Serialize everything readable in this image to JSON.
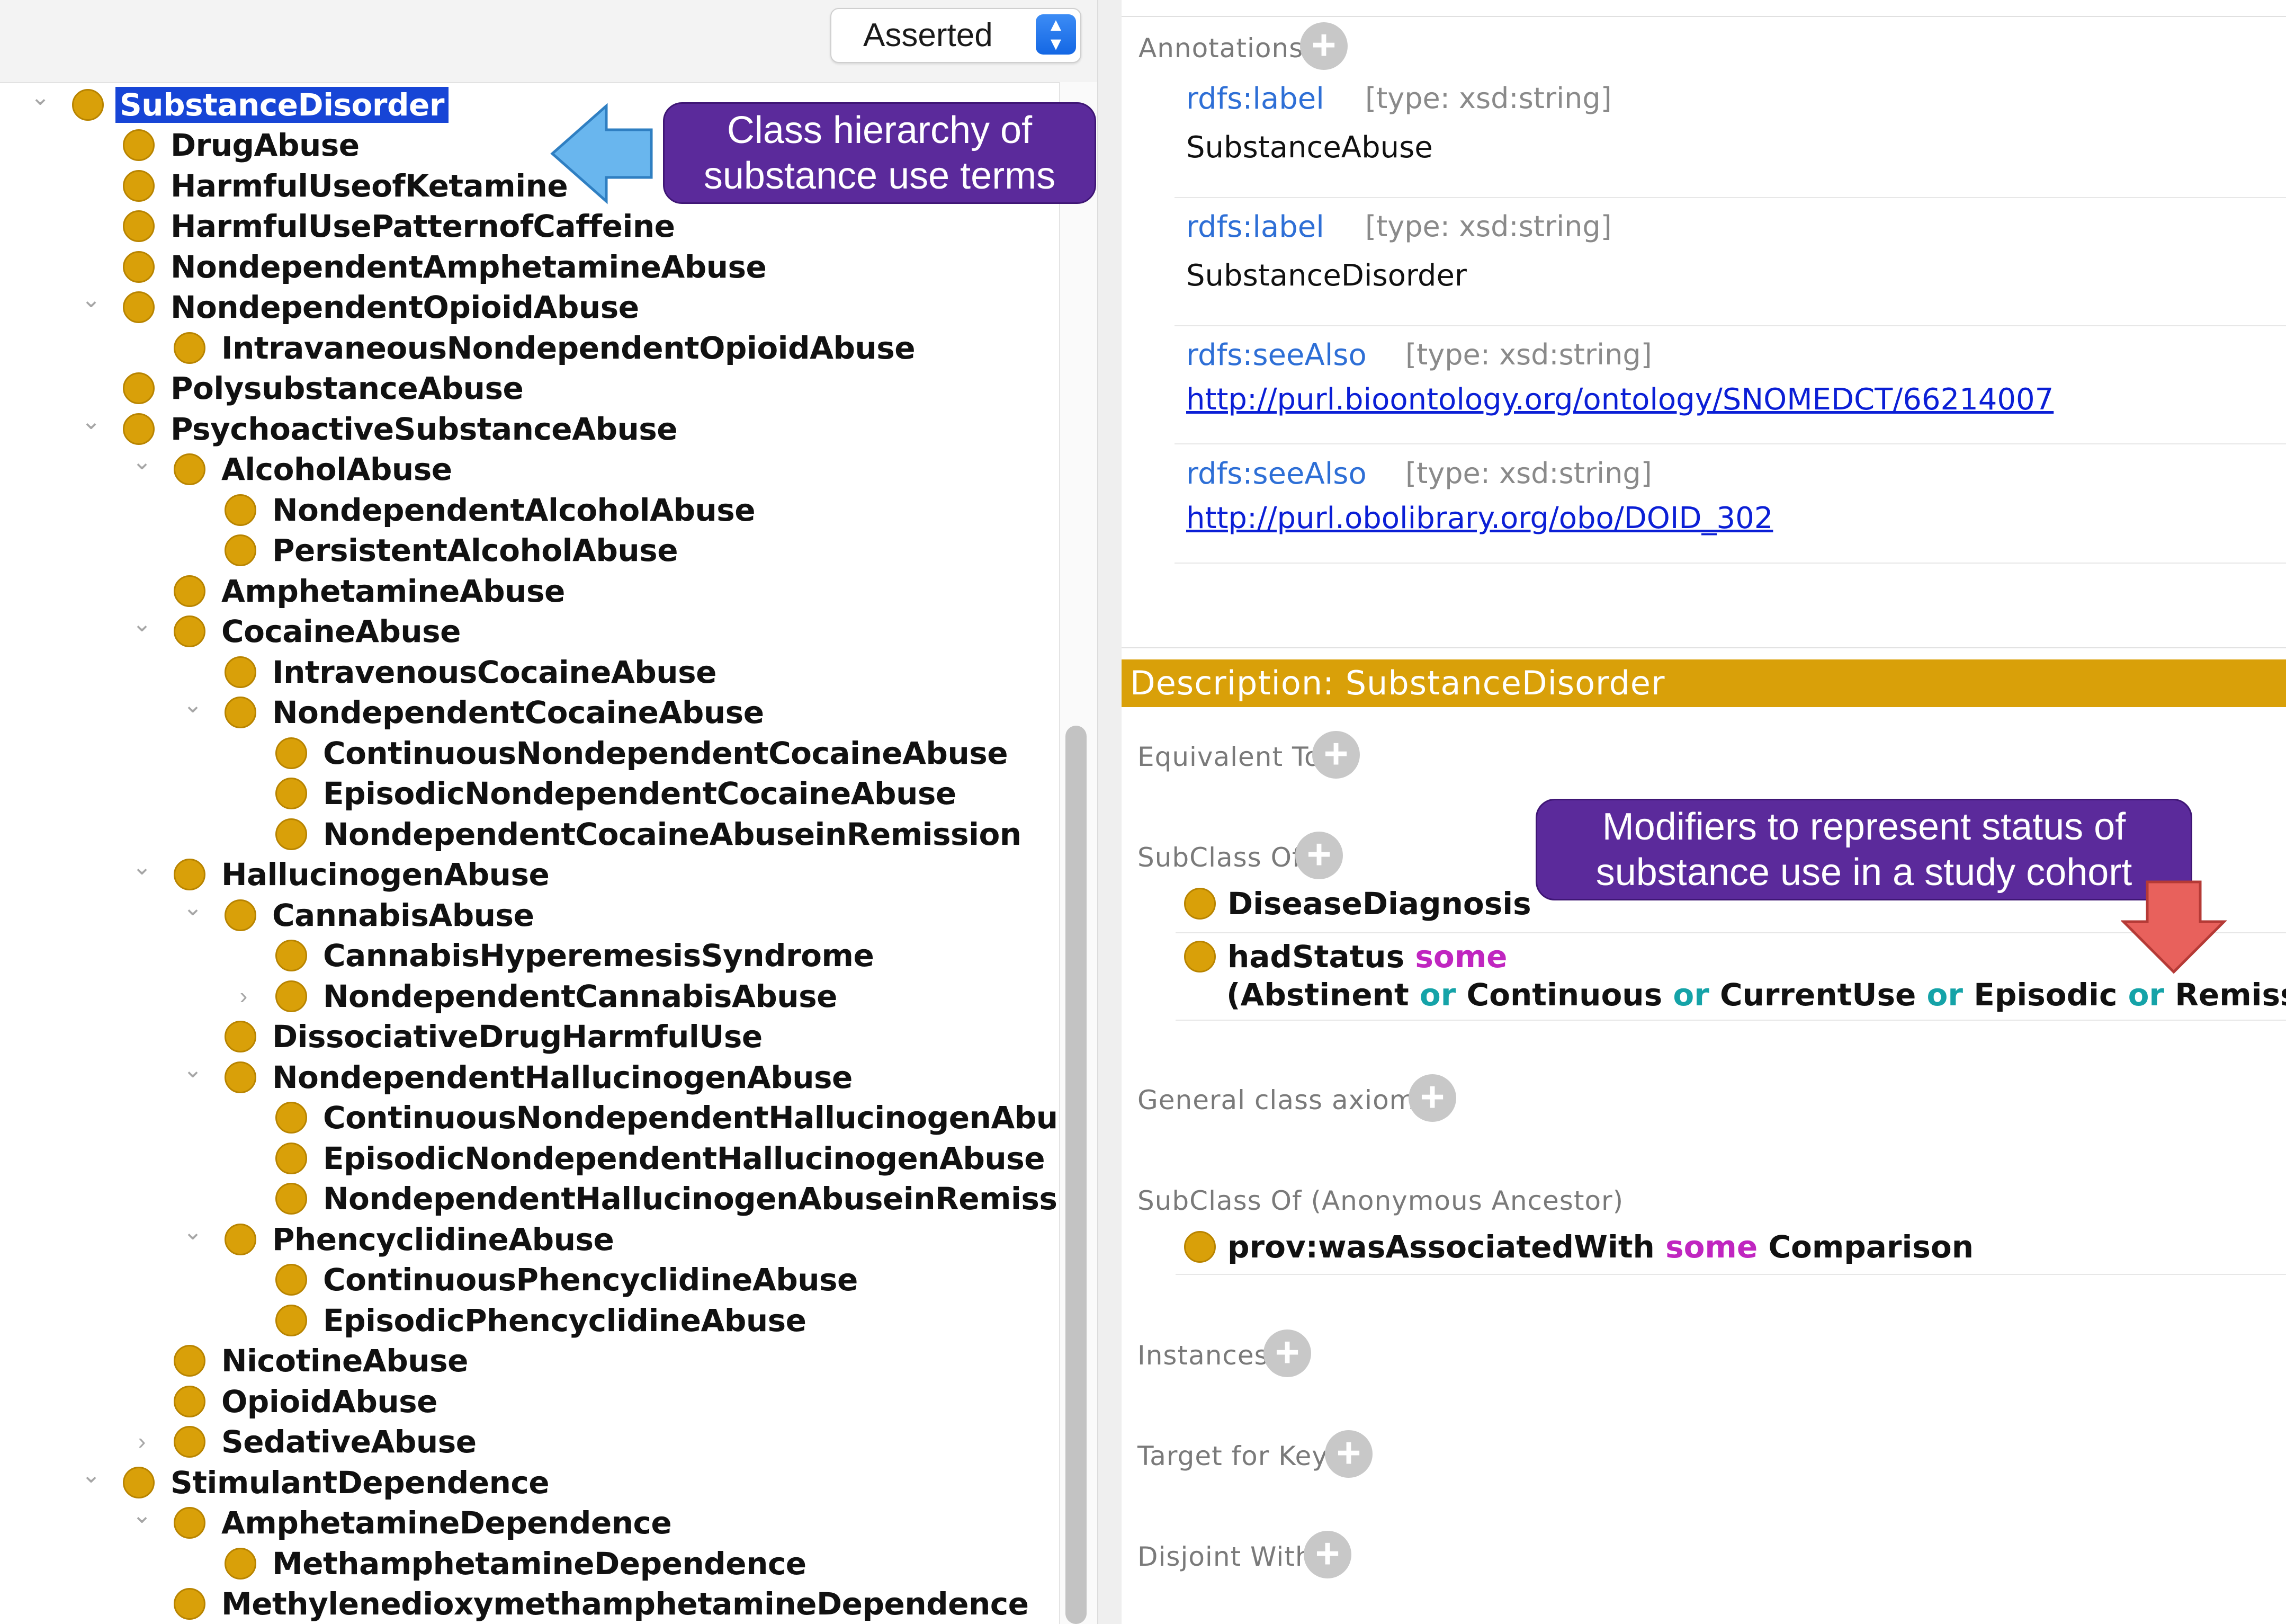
{
  "toolbar": {
    "view_mode": "Asserted"
  },
  "tree": {
    "items": [
      {
        "label": "SubstanceDisorder",
        "depth": 0,
        "twisty": "open",
        "selected": true
      },
      {
        "label": "DrugAbuse",
        "depth": 1
      },
      {
        "label": "HarmfulUseofKetamine",
        "depth": 1
      },
      {
        "label": "HarmfulUsePatternofCaffeine",
        "depth": 1
      },
      {
        "label": "NondependentAmphetamineAbuse",
        "depth": 1
      },
      {
        "label": "NondependentOpioidAbuse",
        "depth": 1,
        "twisty": "open"
      },
      {
        "label": "IntravaneousNondependentOpioidAbuse",
        "depth": 2
      },
      {
        "label": "PolysubstanceAbuse",
        "depth": 1
      },
      {
        "label": "PsychoactiveSubstanceAbuse",
        "depth": 1,
        "twisty": "open"
      },
      {
        "label": "AlcoholAbuse",
        "depth": 2,
        "twisty": "open"
      },
      {
        "label": "NondependentAlcoholAbuse",
        "depth": 3
      },
      {
        "label": "PersistentAlcoholAbuse",
        "depth": 3
      },
      {
        "label": "AmphetamineAbuse",
        "depth": 2
      },
      {
        "label": "CocaineAbuse",
        "depth": 2,
        "twisty": "open"
      },
      {
        "label": "IntravenousCocaineAbuse",
        "depth": 3
      },
      {
        "label": "NondependentCocaineAbuse",
        "depth": 3,
        "twisty": "open"
      },
      {
        "label": "ContinuousNondependentCocaineAbuse",
        "depth": 4
      },
      {
        "label": "EpisodicNondependentCocaineAbuse",
        "depth": 4
      },
      {
        "label": "NondependentCocaineAbuseinRemission",
        "depth": 4
      },
      {
        "label": "HallucinogenAbuse",
        "depth": 2,
        "twisty": "open"
      },
      {
        "label": "CannabisAbuse",
        "depth": 3,
        "twisty": "open"
      },
      {
        "label": "CannabisHyperemesisSyndrome",
        "depth": 4
      },
      {
        "label": "NondependentCannabisAbuse",
        "depth": 4,
        "twisty": "closed"
      },
      {
        "label": "DissociativeDrugHarmfulUse",
        "depth": 3
      },
      {
        "label": "NondependentHallucinogenAbuse",
        "depth": 3,
        "twisty": "open"
      },
      {
        "label": "ContinuousNondependentHallucinogenAbuse",
        "depth": 4
      },
      {
        "label": "EpisodicNondependentHallucinogenAbuse",
        "depth": 4
      },
      {
        "label": "NondependentHallucinogenAbuseinRemission",
        "depth": 4
      },
      {
        "label": "PhencyclidineAbuse",
        "depth": 3,
        "twisty": "open"
      },
      {
        "label": "ContinuousPhencyclidineAbuse",
        "depth": 4
      },
      {
        "label": "EpisodicPhencyclidineAbuse",
        "depth": 4
      },
      {
        "label": "NicotineAbuse",
        "depth": 2
      },
      {
        "label": "OpioidAbuse",
        "depth": 2
      },
      {
        "label": "SedativeAbuse",
        "depth": 2,
        "twisty": "closed"
      },
      {
        "label": "StimulantDependence",
        "depth": 1,
        "twisty": "open"
      },
      {
        "label": "AmphetamineDependence",
        "depth": 2,
        "twisty": "open"
      },
      {
        "label": "MethamphetamineDependence",
        "depth": 3
      },
      {
        "label": "MethylenedioxymethamphetamineDependence",
        "depth": 2
      }
    ]
  },
  "callouts": {
    "left": [
      "Class hierarchy of",
      "substance use terms"
    ],
    "right": [
      "Modifiers to represent status of",
      "substance use in a study cohort"
    ]
  },
  "annotations": {
    "title": "Annotations",
    "entries": [
      {
        "property": "rdfs:label",
        "type": "[type: xsd:string]",
        "value": "SubstanceAbuse"
      },
      {
        "property": "rdfs:label",
        "type": "[type: xsd:string]",
        "value": "SubstanceDisorder"
      },
      {
        "property": "rdfs:seeAlso",
        "type": "[type: xsd:string]",
        "link": "http://purl.bioontology.org/ontology/SNOMEDCT/66214007"
      },
      {
        "property": "rdfs:seeAlso",
        "type": "[type: xsd:string]",
        "link": "http://purl.obolibrary.org/obo/DOID_302"
      }
    ]
  },
  "description": {
    "header": "Description: SubstanceDisorder",
    "equivalent_to": "Equivalent To",
    "subclass_of": "SubClass Of",
    "subclass_items": {
      "diagnosis": "DiseaseDiagnosis",
      "status_prop": "hadStatus",
      "kw_some": "some",
      "kw_or": "or",
      "open_paren": "(Abstinent",
      "continuous": "Continuous",
      "current_use": "CurrentUse",
      "episodic": "Episodic",
      "remission": "Remission)"
    },
    "general_axioms": "General class axioms",
    "anon_ancestor": "SubClass Of (Anonymous Ancestor)",
    "anon_item": {
      "prop": "prov:wasAssociatedWith",
      "kw": "some",
      "filler": "Comparison"
    },
    "instances": "Instances",
    "target_for_key": "Target for Key",
    "disjoint_with": "Disjoint With"
  },
  "colors": {
    "bullet": "#d9a009",
    "header": "#d9a009",
    "selection": "#1745d6",
    "callout": "#5b2a9b",
    "link": "#0b1fd6",
    "prop": "#2e6fd6",
    "keyword_some": "#c026c0",
    "keyword_or": "#15a3a8"
  }
}
